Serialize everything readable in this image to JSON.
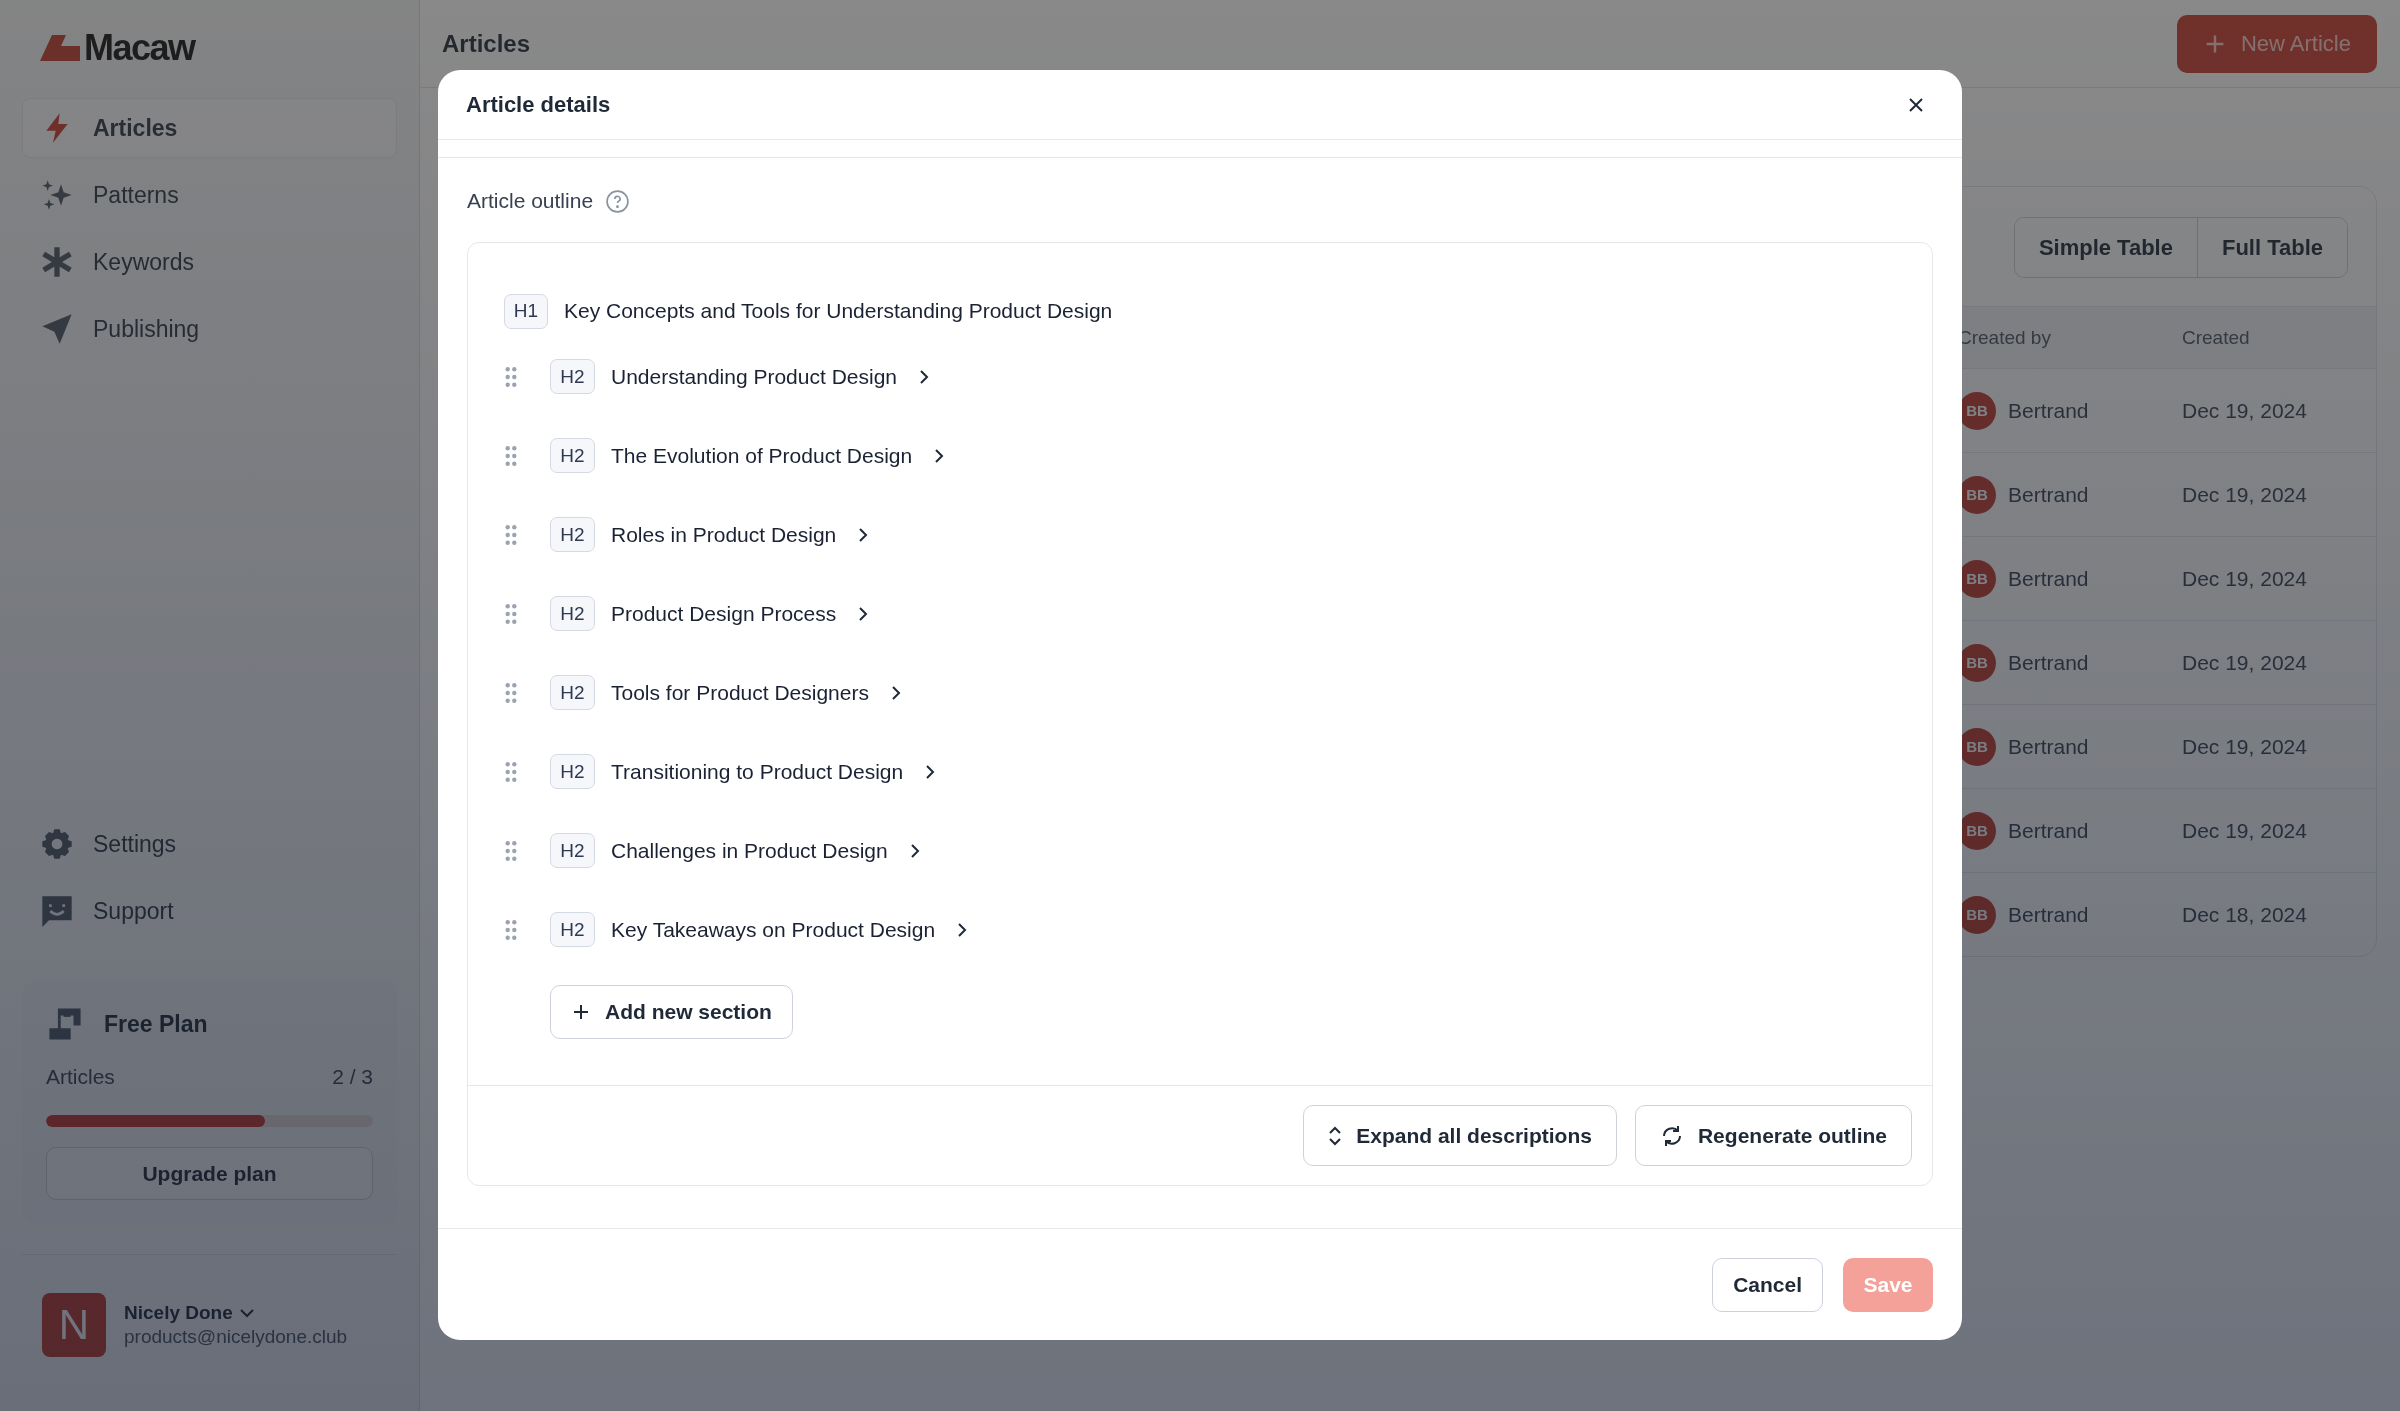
{
  "brand": {
    "name": "Macaw"
  },
  "sidebar": {
    "items": [
      {
        "label": "Articles",
        "selected": true
      },
      {
        "label": "Patterns",
        "selected": false
      },
      {
        "label": "Keywords",
        "selected": false
      },
      {
        "label": "Publishing",
        "selected": false
      }
    ],
    "bottom_items": [
      {
        "label": "Settings",
        "selected": false
      },
      {
        "label": "Support",
        "selected": false
      }
    ],
    "plan": {
      "title": "Free Plan",
      "label": "Articles",
      "count": "2 / 3",
      "level": 0.67,
      "button": "Upgrade plan"
    },
    "user": {
      "initial": "N",
      "name": "Nicely Done",
      "email": "products@nicelydone.club"
    }
  },
  "header": {
    "title": "Articles",
    "button": "New Article"
  },
  "view_toggle": [
    "Simple Table",
    "Full Table"
  ],
  "table": {
    "columns": [
      "Created by",
      "Created"
    ],
    "rows": [
      {
        "initials": "BB",
        "created_by": "Bertrand",
        "created": "Dec 19, 2024"
      },
      {
        "initials": "BB",
        "created_by": "Bertrand",
        "created": "Dec 19, 2024"
      },
      {
        "initials": "BB",
        "created_by": "Bertrand",
        "created": "Dec 19, 2024"
      },
      {
        "initials": "BB",
        "created_by": "Bertrand",
        "created": "Dec 19, 2024"
      },
      {
        "initials": "BB",
        "created_by": "Bertrand",
        "created": "Dec 19, 2024"
      },
      {
        "initials": "BB",
        "created_by": "Bertrand",
        "created": "Dec 19, 2024"
      },
      {
        "initials": "BB",
        "created_by": "Bertrand",
        "created": "Dec 18, 2024"
      }
    ]
  },
  "dialog": {
    "title": "Article details",
    "outline_label": "Article outline",
    "outline": [
      {
        "level": "H1",
        "title": "Key Concepts and Tools for Understanding Product Design"
      },
      {
        "level": "H2",
        "title": "Understanding Product Design",
        "expanded": false
      },
      {
        "level": "H2",
        "title": "The Evolution of Product Design",
        "expanded": false
      },
      {
        "level": "H2",
        "title": "Roles in Product Design",
        "expanded": false
      },
      {
        "level": "H2",
        "title": "Product Design Process",
        "expanded": false
      },
      {
        "level": "H2",
        "title": "Tools for Product Designers",
        "expanded": false
      },
      {
        "level": "H2",
        "title": "Transitioning to Product Design",
        "expanded": false
      },
      {
        "level": "H2",
        "title": "Challenges in Product Design",
        "expanded": false
      },
      {
        "level": "H2",
        "title": "Key Takeaways on Product Design",
        "expanded": false
      }
    ],
    "add_section": "Add new section",
    "expand_all": "Expand all descriptions",
    "regenerate": "Regenerate outline",
    "cancel": "Cancel",
    "save": {
      "label": "Save",
      "disabled": true
    }
  }
}
